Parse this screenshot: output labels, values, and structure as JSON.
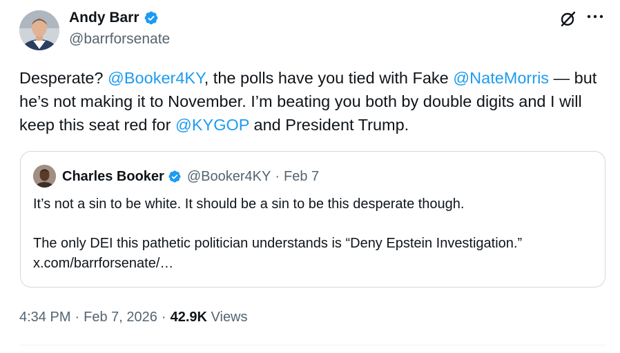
{
  "author": {
    "name": "Andy Barr",
    "handle": "@barrforsenate",
    "avatar_icon": "profile-photo"
  },
  "tweet": {
    "segments": [
      {
        "type": "text",
        "text": "Desperate? "
      },
      {
        "type": "mention",
        "text": "@Booker4KY"
      },
      {
        "type": "text",
        "text": ", the polls have you tied with Fake "
      },
      {
        "type": "mention",
        "text": "@NateMorris"
      },
      {
        "type": "text",
        "text": " — but he’s not making it to November. I’m beating you both by double digits and I will keep this seat red for "
      },
      {
        "type": "mention",
        "text": "@KYGOP"
      },
      {
        "type": "text",
        "text": " and President Trump."
      }
    ]
  },
  "quoted": {
    "name": "Charles Booker",
    "handle": "@Booker4KY",
    "separator": "·",
    "date": "Feb 7",
    "line1": "It’s not a sin to be white. It should be a sin to be this desperate though.",
    "line2": "The only DEI this pathetic politician understands is “Deny Epstein Investigation.” x.com/barrforsenate/…"
  },
  "meta": {
    "time": "4:34 PM",
    "separator": "·",
    "date": "Feb 7, 2026",
    "views_count": "42.9K",
    "views_label": "Views"
  },
  "colors": {
    "link": "#1d9bf0",
    "text": "#0f1419",
    "secondary": "#536471",
    "border": "#cfd9de",
    "verified": "#1d9bf0"
  },
  "icons": {
    "verified": "verified-badge-icon",
    "grok": "grok-icon",
    "more": "more-dots-icon"
  }
}
